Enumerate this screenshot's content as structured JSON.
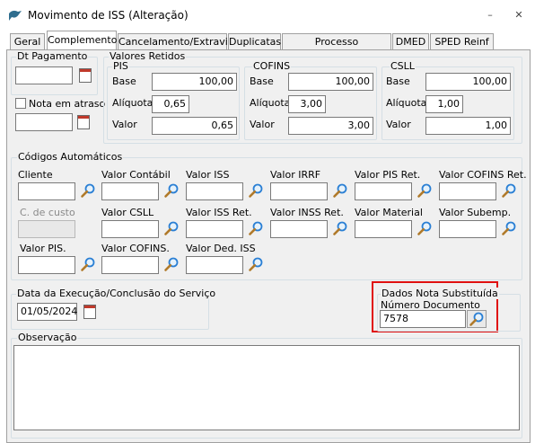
{
  "window": {
    "title": "Movimento de ISS (Alteração)",
    "minimize": "–",
    "close": "✕"
  },
  "tabs": [
    "Geral",
    "Complemento",
    "Cancelamento/Extravio",
    "Duplicatas",
    "Processo Referenciado",
    "DMED",
    "SPED Reinf"
  ],
  "dt_pagamento": {
    "label": "Dt Pagamento",
    "value": ""
  },
  "nota_em_atraso": {
    "label": "Nota em atraso",
    "value": ""
  },
  "valores_retidos": {
    "label": "Valores Retidos",
    "pis": {
      "label": "PIS",
      "base_label": "Base",
      "base": "100,00",
      "aliquota_label": "Alíquota",
      "aliquota": "0,65",
      "valor_label": "Valor",
      "valor": "0,65"
    },
    "cofins": {
      "label": "COFINS",
      "base_label": "Base",
      "base": "100,00",
      "aliquota_label": "Alíquota",
      "aliquota": "3,00",
      "valor_label": "Valor",
      "valor": "3,00"
    },
    "csll": {
      "label": "CSLL",
      "base_label": "Base",
      "base": "100,00",
      "aliquota_label": "Alíquota",
      "aliquota": "1,00",
      "valor_label": "Valor",
      "valor": "1,00"
    }
  },
  "codigos": {
    "label": "Códigos Automáticos",
    "row1": [
      "Cliente",
      "Valor Contábil",
      "Valor ISS",
      "Valor IRRF",
      "Valor PIS Ret.",
      "Valor COFINS Ret."
    ],
    "row2": [
      "C. de custo",
      "Valor CSLL",
      "Valor ISS Ret.",
      "Valor INSS Ret.",
      "Valor Material",
      "Valor Subemp."
    ],
    "row3": [
      "Valor PIS.",
      "Valor COFINS.",
      "Valor Ded. ISS"
    ]
  },
  "data_execucao": {
    "label": "Data da Execução/Conclusão do Serviço",
    "value": "01/05/2024"
  },
  "nota_substituida": {
    "label": "Dados Nota Substituída",
    "numero_label": "Número Documento",
    "numero": "7578"
  },
  "observacao": {
    "label": "Observação",
    "value": ""
  },
  "colors": {
    "highlight": "#e01010",
    "calendar": "#c0392b",
    "magnifier": "#2a7fd4"
  }
}
